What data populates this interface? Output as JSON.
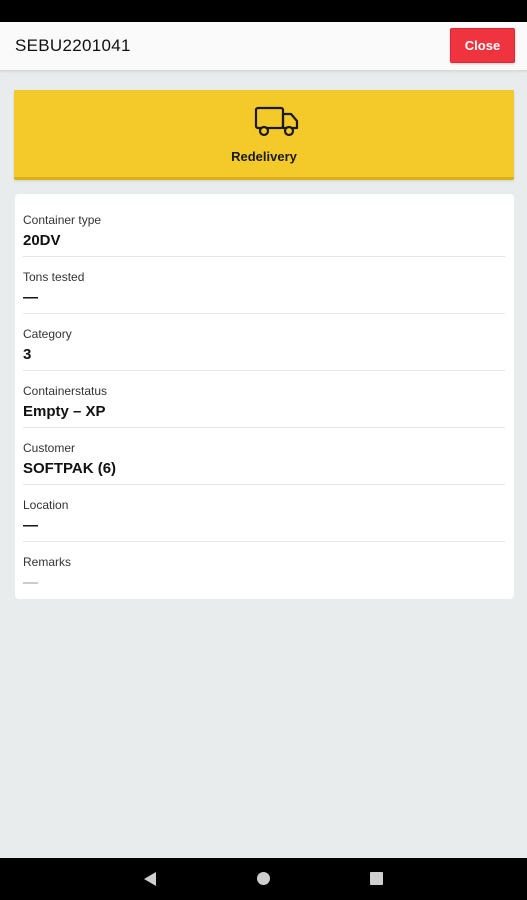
{
  "header": {
    "title": "SEBU2201041",
    "close_label": "Close"
  },
  "action": {
    "label": "Redelivery",
    "icon": "truck-icon",
    "color": "#f3ca2a"
  },
  "details": [
    {
      "label": "Container type",
      "value": "20DV"
    },
    {
      "label": "Tons tested",
      "value": "—"
    },
    {
      "label": "Category",
      "value": "3"
    },
    {
      "label": "Containerstatus",
      "value": "Empty – XP"
    },
    {
      "label": "Customer",
      "value": "SOFTPAK (6)"
    },
    {
      "label": "Location",
      "value": "—"
    },
    {
      "label": "Remarks",
      "value": "—"
    }
  ],
  "colors": {
    "close_button": "#f0343f",
    "background": "#e9eced"
  },
  "system_nav": {
    "back": "back-triangle-icon",
    "home": "home-circle-icon",
    "recents": "recents-square-icon"
  }
}
